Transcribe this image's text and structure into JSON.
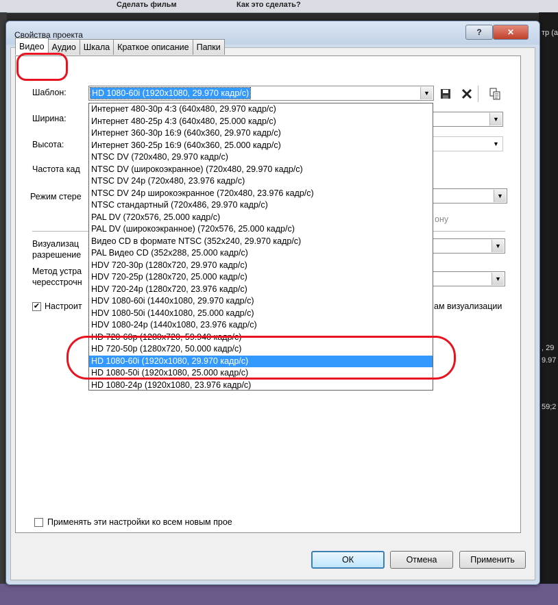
{
  "background": {
    "toolbar_items": [
      "Сделать фильм",
      "Как это сделать?"
    ],
    "right_texts": [
      "тр (а",
      ", 29",
      "9.97",
      "59;2"
    ]
  },
  "dialog": {
    "title": "Свойства проекта",
    "help_glyph": "?",
    "close_glyph": "✕"
  },
  "tabs": [
    {
      "label": "Видео",
      "active": true
    },
    {
      "label": "Аудио",
      "active": false
    },
    {
      "label": "Шкала",
      "active": false
    },
    {
      "label": "Краткое описание",
      "active": false
    },
    {
      "label": "Папки",
      "active": false
    }
  ],
  "form": {
    "template_label": "Шаблон:",
    "template_value": "HD 1080-60i (1920x1080, 29.970 кадр/с)",
    "width_label": "Ширина:",
    "height_label": "Высота:",
    "framerate_label": "Частота кад",
    "stereo_label": "Режим стере",
    "stereo_suffix": "ону",
    "render_label_1": "Визуализац",
    "render_label_2": "разрешение",
    "deinterlace_label_1": "Метод устра",
    "deinterlace_label_2": "чересстрочн",
    "adjust_label": "Настроит",
    "adjust_suffix": "ам визуализации",
    "adjust_checked": true,
    "apply_all_label": "Применять эти настройки ко всем новым прое",
    "apply_all_checked": false
  },
  "icons": {
    "save": "save-icon",
    "delete": "delete-icon",
    "copy": "copy-icon"
  },
  "dropdown": {
    "items": [
      "Интернет 480-30p 4:3 (640x480, 29.970 кадр/с)",
      "Интернет 480-25p 4:3 (640x480, 25.000 кадр/с)",
      "Интернет 360-30p 16:9 (640x360, 29.970 кадр/с)",
      "Интернет 360-25p 16:9 (640x360, 25.000 кадр/с)",
      "NTSC DV (720x480, 29.970 кадр/с)",
      "NTSC DV (широкоэкранное) (720x480, 29.970 кадр/с)",
      "NTSC DV 24p (720x480, 23.976 кадр/с)",
      "NTSC DV 24p широкоэкранное (720x480, 23.976 кадр/с)",
      "NTSC стандартный (720x486, 29.970 кадр/с)",
      "PAL DV (720x576, 25.000 кадр/с)",
      "PAL DV (широкоэкранное) (720x576, 25.000 кадр/с)",
      "Видео CD в формате NTSC (352x240, 29.970 кадр/с)",
      "PAL Видео CD (352x288, 25.000 кадр/с)",
      "HDV 720-30p (1280x720, 29.970 кадр/с)",
      "HDV 720-25p (1280x720, 25.000 кадр/с)",
      "HDV 720-24p (1280x720, 23.976 кадр/с)",
      "HDV 1080-60i (1440x1080, 29.970 кадр/с)",
      "HDV 1080-50i (1440x1080, 25.000 кадр/с)",
      "HDV 1080-24p (1440x1080, 23.976 кадр/с)",
      "HD 720-60p (1280x720, 59.940 кадр/с)",
      "HD 720-50p (1280x720, 50.000 кадр/с)",
      "HD 1080-60i (1920x1080, 29.970 кадр/с)",
      "HD 1080-50i (1920x1080, 25.000 кадр/с)",
      "HD 1080-24p (1920x1080, 23.976 кадр/с)"
    ],
    "selected_index": 21
  },
  "buttons": {
    "ok": "ОК",
    "cancel": "Отмена",
    "apply": "Применить"
  },
  "colors": {
    "selection": "#3399ff",
    "highlight_annotation": "#e8131f"
  }
}
